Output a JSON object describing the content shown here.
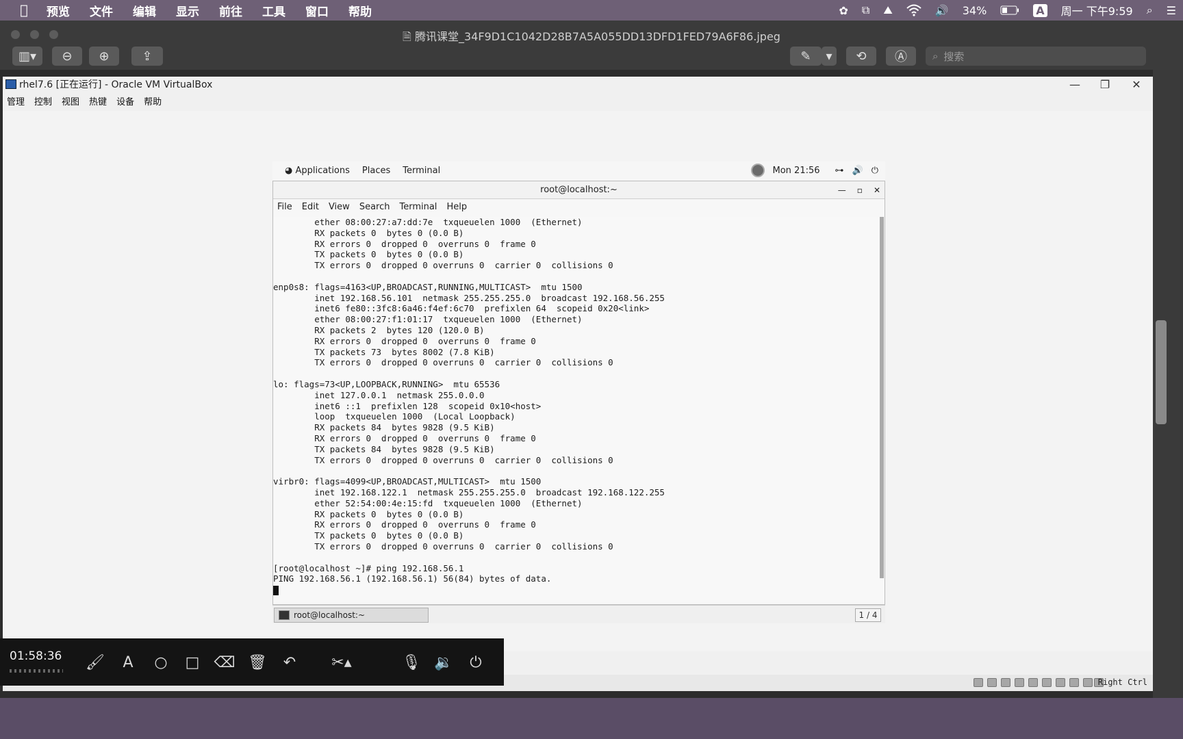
{
  "mac_menubar": {
    "app_name": "预览",
    "items": [
      "文件",
      "编辑",
      "显示",
      "前往",
      "工具",
      "窗口",
      "帮助"
    ],
    "battery": "34%",
    "input_method": "A",
    "clock": "周一 下午9:59"
  },
  "preview": {
    "file_title": "腾讯课堂_34F9D1C1042D28B7A5A055DD13DFD1FED79A6F86.jpeg",
    "search_placeholder": "搜索"
  },
  "vbox": {
    "title": "rhel7.6 [正在运行] - Oracle VM VirtualBox",
    "menu": [
      "管理",
      "控制",
      "视图",
      "热键",
      "设备",
      "帮助"
    ],
    "host_key": "Right Ctrl"
  },
  "gnome": {
    "applications": "Applications",
    "places": "Places",
    "terminal": "Terminal",
    "clock": "Mon 21:56"
  },
  "terminal": {
    "title": "root@localhost:~",
    "menu": [
      "File",
      "Edit",
      "View",
      "Search",
      "Terminal",
      "Help"
    ],
    "lines": [
      "        ether 08:00:27:a7:dd:7e  txqueuelen 1000  (Ethernet)",
      "        RX packets 0  bytes 0 (0.0 B)",
      "        RX errors 0  dropped 0  overruns 0  frame 0",
      "        TX packets 0  bytes 0 (0.0 B)",
      "        TX errors 0  dropped 0 overruns 0  carrier 0  collisions 0",
      "",
      "enp0s8: flags=4163<UP,BROADCAST,RUNNING,MULTICAST>  mtu 1500",
      "        inet 192.168.56.101  netmask 255.255.255.0  broadcast 192.168.56.255",
      "        inet6 fe80::3fc8:6a46:f4ef:6c70  prefixlen 64  scopeid 0x20<link>",
      "        ether 08:00:27:f1:01:17  txqueuelen 1000  (Ethernet)",
      "        RX packets 2  bytes 120 (120.0 B)",
      "        RX errors 0  dropped 0  overruns 0  frame 0",
      "        TX packets 73  bytes 8002 (7.8 KiB)",
      "        TX errors 0  dropped 0 overruns 0  carrier 0  collisions 0",
      "",
      "lo: flags=73<UP,LOOPBACK,RUNNING>  mtu 65536",
      "        inet 127.0.0.1  netmask 255.0.0.0",
      "        inet6 ::1  prefixlen 128  scopeid 0x10<host>",
      "        loop  txqueuelen 1000  (Local Loopback)",
      "        RX packets 84  bytes 9828 (9.5 KiB)",
      "        RX errors 0  dropped 0  overruns 0  frame 0",
      "        TX packets 84  bytes 9828 (9.5 KiB)",
      "        TX errors 0  dropped 0 overruns 0  carrier 0  collisions 0",
      "",
      "virbr0: flags=4099<UP,BROADCAST,MULTICAST>  mtu 1500",
      "        inet 192.168.122.1  netmask 255.255.255.0  broadcast 192.168.122.255",
      "        ether 52:54:00:4e:15:fd  txqueuelen 1000  (Ethernet)",
      "        RX packets 0  bytes 0 (0.0 B)",
      "        RX errors 0  dropped 0  overruns 0  frame 0",
      "        TX packets 0  bytes 0 (0.0 B)",
      "        TX errors 0  dropped 0 overruns 0  carrier 0  collisions 0",
      "",
      "[root@localhost ~]# ping 192.168.56.1",
      "PING 192.168.56.1 (192.168.56.1) 56(84) bytes of data."
    ],
    "taskbar_item": "root@localhost:~",
    "workspace": "1 / 4"
  },
  "recorder": {
    "elapsed": "01:58:36"
  }
}
